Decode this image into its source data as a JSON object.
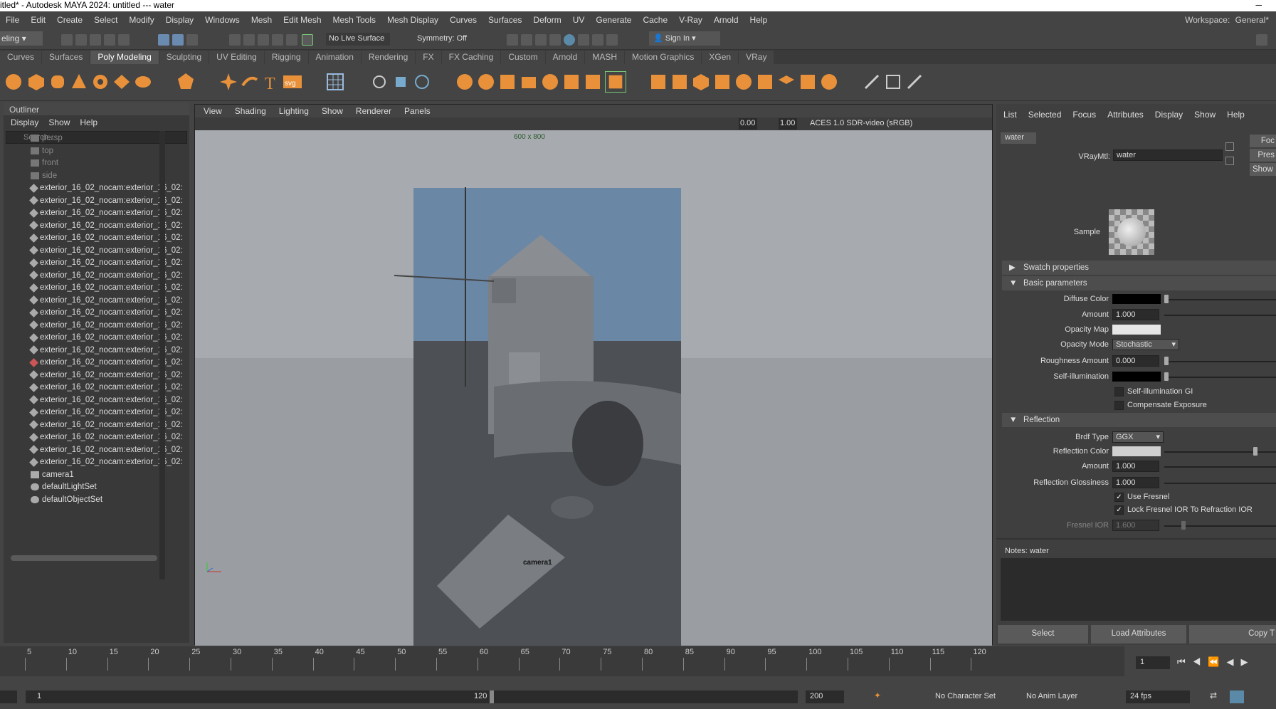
{
  "window": {
    "title": "itled* - Autodesk MAYA 2024: untitled   ---   water"
  },
  "menu": [
    "File",
    "Edit",
    "Create",
    "Select",
    "Modify",
    "Display",
    "Windows",
    "Mesh",
    "Edit Mesh",
    "Mesh Tools",
    "Mesh Display",
    "Curves",
    "Surfaces",
    "Deform",
    "UV",
    "Generate",
    "Cache",
    "V-Ray",
    "Arnold",
    "Help"
  ],
  "workspace": {
    "label": "Workspace:",
    "value": "General*"
  },
  "status": {
    "mode": "eling",
    "live_surface": "No Live Surface",
    "symmetry": "Symmetry: Off",
    "sign_in": "Sign In"
  },
  "shelf_tabs": [
    "Curves",
    "Surfaces",
    "Poly Modeling",
    "Sculpting",
    "UV Editing",
    "Rigging",
    "Animation",
    "Rendering",
    "FX",
    "FX Caching",
    "Custom",
    "Arnold",
    "MASH",
    "Motion Graphics",
    "XGen",
    "VRay"
  ],
  "shelf_active": "Poly Modeling",
  "outliner": {
    "title": "Outliner",
    "menu": [
      "Display",
      "Show",
      "Help"
    ],
    "search_placeholder": "Search...",
    "cameras": [
      "persp",
      "top",
      "front",
      "side"
    ],
    "items": [
      "exterior_16_02_nocam:exterior_16_02:",
      "exterior_16_02_nocam:exterior_16_02:",
      "exterior_16_02_nocam:exterior_16_02:",
      "exterior_16_02_nocam:exterior_16_02:",
      "exterior_16_02_nocam:exterior_16_02:",
      "exterior_16_02_nocam:exterior_16_02:",
      "exterior_16_02_nocam:exterior_16_02:",
      "exterior_16_02_nocam:exterior_16_02:",
      "exterior_16_02_nocam:exterior_16_02:",
      "exterior_16_02_nocam:exterior_16_02:",
      "exterior_16_02_nocam:exterior_16_02:",
      "exterior_16_02_nocam:exterior_16_02:",
      "exterior_16_02_nocam:exterior_16_02:",
      "exterior_16_02_nocam:exterior_16_02:",
      "exterior_16_02_nocam:exterior_16_02:",
      "exterior_16_02_nocam:exterior_16_02:",
      "exterior_16_02_nocam:exterior_16_02:",
      "exterior_16_02_nocam:exterior_16_02:",
      "exterior_16_02_nocam:exterior_16_02:",
      "exterior_16_02_nocam:exterior_16_02:",
      "exterior_16_02_nocam:exterior_16_02:",
      "exterior_16_02_nocam:exterior_16_02:",
      "exterior_16_02_nocam:exterior_16_02:"
    ],
    "extras": [
      "camera1",
      "defaultLightSet",
      "defaultObjectSet"
    ]
  },
  "viewport": {
    "menu": [
      "View",
      "Shading",
      "Lighting",
      "Show",
      "Renderer",
      "Panels"
    ],
    "field1": "0.00",
    "field2": "1.00",
    "colorspace": "ACES 1.0 SDR-video (sRGB)",
    "resolution": "600 x 800",
    "camera": "camera1"
  },
  "attr": {
    "menu": [
      "List",
      "Selected",
      "Focus",
      "Attributes",
      "Display",
      "Show",
      "Help"
    ],
    "tab": "water",
    "node_label": "VRayMtl:",
    "node_name": "water",
    "btn_focus": "Foc",
    "btn_presets": "Pres",
    "btn_show": "Show",
    "sample_label": "Sample",
    "swatch_section": "Swatch properties",
    "basic_section": "Basic parameters",
    "diffuse_color": "Diffuse Color",
    "amount": "Amount",
    "amount_val": "1.000",
    "opacity_map": "Opacity Map",
    "opacity_mode": "Opacity Mode",
    "opacity_mode_val": "Stochastic",
    "roughness": "Roughness Amount",
    "roughness_val": "0.000",
    "self_illum": "Self-illumination",
    "self_illum_gi": "Self-illumination GI",
    "comp_exposure": "Compensate Exposure",
    "reflection_section": "Reflection",
    "brdf": "Brdf Type",
    "brdf_val": "GGX",
    "refl_color": "Reflection Color",
    "refl_amount": "Amount",
    "refl_amount_val": "1.000",
    "refl_gloss": "Reflection Glossiness",
    "refl_gloss_val": "1.000",
    "use_fresnel": "Use Fresnel",
    "lock_fresnel": "Lock Fresnel IOR To Refraction IOR",
    "fresnel_ior": "Fresnel IOR",
    "fresnel_ior_val": "1.600",
    "notes": "Notes:  water",
    "btn_select": "Select",
    "btn_load": "Load Attributes",
    "btn_copy": "Copy T"
  },
  "timeline": {
    "ticks": [
      "5",
      "10",
      "15",
      "20",
      "25",
      "30",
      "35",
      "40",
      "45",
      "50",
      "55",
      "60",
      "65",
      "70",
      "75",
      "80",
      "85",
      "90",
      "95",
      "100",
      "105",
      "110",
      "115",
      "120"
    ],
    "current": "1"
  },
  "range": {
    "start": "1",
    "end": "120",
    "total": "200",
    "char_set": "No Character Set",
    "anim_layer": "No Anim Layer",
    "fps": "24 fps"
  },
  "colors": {
    "accent_orange": "#e8913a",
    "bg": "#444444"
  }
}
